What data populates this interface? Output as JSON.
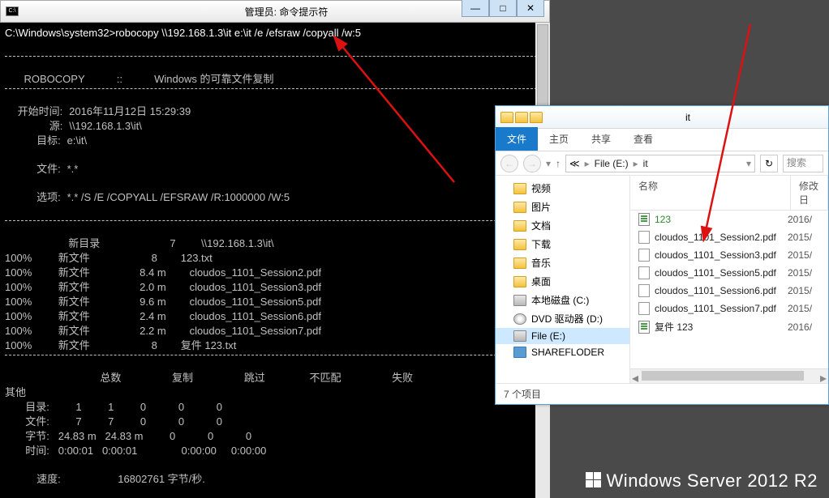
{
  "cmd": {
    "title_prefix": "管理员: ",
    "title": "命令提示符",
    "icon_text": "C:\\",
    "prompt": "C:\\Windows\\system32>",
    "command": "robocopy \\\\192.168.1.3\\it e:\\it /e /efsraw /copyall /w:5",
    "banner_label": "ROBOCOPY",
    "banner_sep": "::",
    "banner_desc": "Windows 的可靠文件复制",
    "start_label": "开始时间:",
    "start_value": "2016年11月12日 15:29:39",
    "src_label": "源:",
    "src_value": "\\\\192.168.1.3\\it\\",
    "dst_label": "目标:",
    "dst_value": "e:\\it\\",
    "files_label": "文件:",
    "files_value": "*.*",
    "opts_label": "选项:",
    "opts_value": "*.* /S /E /COPYALL /EFSRAW /R:1000000 /W:5",
    "newdir_label": "新目录",
    "newdir_count": "7",
    "newdir_path": "\\\\192.168.1.3\\it\\",
    "rows": [
      {
        "pct": "100%",
        "tag": "新文件",
        "size": "8",
        "name": "123.txt"
      },
      {
        "pct": "100%",
        "tag": "新文件",
        "size": "8.4 m",
        "name": "cloudos_1101_Session2.pdf"
      },
      {
        "pct": "100%",
        "tag": "新文件",
        "size": "2.0 m",
        "name": "cloudos_1101_Session3.pdf"
      },
      {
        "pct": "100%",
        "tag": "新文件",
        "size": "9.6 m",
        "name": "cloudos_1101_Session5.pdf"
      },
      {
        "pct": "100%",
        "tag": "新文件",
        "size": "2.4 m",
        "name": "cloudos_1101_Session6.pdf"
      },
      {
        "pct": "100%",
        "tag": "新文件",
        "size": "2.2 m",
        "name": "cloudos_1101_Session7.pdf"
      },
      {
        "pct": "100%",
        "tag": "新文件",
        "size": "8",
        "name": "复件 123.txt"
      }
    ],
    "sum_head": {
      "c0": "",
      "c1": "总数",
      "c2": "复制",
      "c3": "跳过",
      "c4": "不匹配",
      "c5": "失败"
    },
    "sum_other": "其他",
    "sum_rows": [
      {
        "k": "目录:",
        "a": "1",
        "b": "1",
        "c": "0",
        "d": "0",
        "e": "0"
      },
      {
        "k": "文件:",
        "a": "7",
        "b": "7",
        "c": "0",
        "d": "0",
        "e": "0"
      },
      {
        "k": "字节:",
        "a": "24.83 m",
        "b": "24.83 m",
        "c": "0",
        "d": "0",
        "e": "0"
      },
      {
        "k": "时间:",
        "a": "0:00:01",
        "b": "0:00:01",
        "c": "",
        "d": "0:00:00",
        "e": "0:00:00"
      }
    ],
    "speed_label": "速度:",
    "speed_value": "16802761 字节/秒."
  },
  "explorer": {
    "title": "it",
    "tabs": {
      "file": "文件",
      "home": "主页",
      "share": "共享",
      "view": "查看"
    },
    "crumb_drive_icon": "≪",
    "crumb_drive": "File (E:)",
    "crumb_folder": "it",
    "search_placeholder": "搜索",
    "tree": [
      {
        "icon": "folder",
        "label": "视频"
      },
      {
        "icon": "folder",
        "label": "图片"
      },
      {
        "icon": "folder",
        "label": "文档"
      },
      {
        "icon": "folder",
        "label": "下载"
      },
      {
        "icon": "folder",
        "label": "音乐"
      },
      {
        "icon": "folder",
        "label": "桌面"
      },
      {
        "icon": "drive",
        "label": "本地磁盘 (C:)"
      },
      {
        "icon": "dvd",
        "label": "DVD 驱动器 (D:)"
      },
      {
        "icon": "drive",
        "label": "File (E:)",
        "sel": true
      },
      {
        "icon": "net",
        "label": "SHAREFLODER"
      }
    ],
    "cols": {
      "name": "名称",
      "date": "修改日"
    },
    "files": [
      {
        "ic": "txt",
        "name": "123",
        "green": true,
        "date": "2016/"
      },
      {
        "ic": "pdf",
        "name": "cloudos_1101_Session2.pdf",
        "date": "2015/"
      },
      {
        "ic": "pdf",
        "name": "cloudos_1101_Session3.pdf",
        "date": "2015/"
      },
      {
        "ic": "pdf",
        "name": "cloudos_1101_Session5.pdf",
        "date": "2015/"
      },
      {
        "ic": "pdf",
        "name": "cloudos_1101_Session6.pdf",
        "date": "2015/"
      },
      {
        "ic": "pdf",
        "name": "cloudos_1101_Session7.pdf",
        "date": "2015/"
      },
      {
        "ic": "txt",
        "name": "复件 123",
        "date": "2016/"
      }
    ],
    "status": "7 个项目"
  },
  "brand": "Windows Server 2012 R2"
}
